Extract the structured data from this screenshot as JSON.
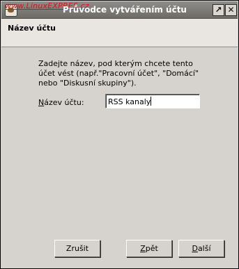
{
  "window": {
    "title": "Průvodce vytvářením účtu",
    "watermark": "www.LinuxEXPRES.cz",
    "maximize_glyph": "↗",
    "close_glyph": "✕"
  },
  "header": {
    "title": "Název účtu"
  },
  "main": {
    "description": "Zadejte název, pod kterým chcete tento účet vést (např.\"Pracovní účet\", \"Domácí\" nebo \"Diskusní skupiny\").",
    "field_label_mnemonic": "N",
    "field_label_rest": "ázev účtu:",
    "field_value": "RSS kanaly"
  },
  "buttons": {
    "cancel": "Zrušit",
    "back_mnemonic": "Z",
    "back_rest": "pět",
    "next_mnemonic": "D",
    "next_rest": "alší"
  }
}
